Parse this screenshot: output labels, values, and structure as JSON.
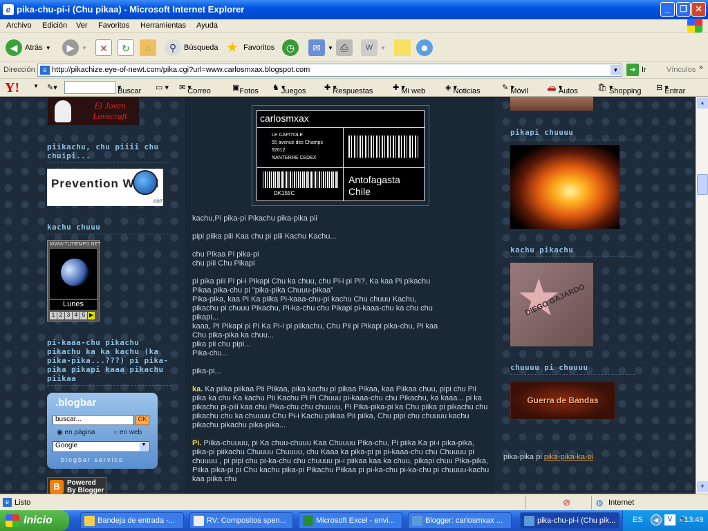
{
  "window": {
    "title": "pika-chu-pi-i (Chu pikaa) - Microsoft Internet Explorer"
  },
  "menu": [
    "Archivo",
    "Edición",
    "Ver",
    "Favoritos",
    "Herramientas",
    "Ayuda"
  ],
  "toolbar": {
    "back": "Atrás",
    "search": "Búsqueda",
    "favorites": "Favoritos"
  },
  "address": {
    "label": "Dirección",
    "url": "http://pikachize.eye-of-newt.com/pika.cgi?url=www.carlosmxax.blogspot.com",
    "go": "Ir",
    "links": "Vínculos"
  },
  "yahoo": {
    "search": "Buscar",
    "items": [
      "Correo",
      "Fotos",
      "Juegos",
      "Respuestas",
      "Mi web",
      "Noticias",
      "Móvil",
      "Autos",
      "Shopping",
      "Entrar"
    ]
  },
  "left": {
    "banner_text": "El Joven Lovecraft",
    "heading1": "piikachu, chu piiii chu chuipi...",
    "prevention": "Prevention World",
    "prevention_sub": ".com",
    "heading2": "kachu chuuu",
    "moon_site": "WWW.TUTIEMPO.NET",
    "moon_day": "Lunes",
    "moon_pages": [
      "1",
      "2",
      "3",
      "4",
      "5"
    ],
    "heading3": "pi-kaaa-chu pikachu pikachu ka ka kachu (ka pika-pika...???) pi pika-pika pikapi kaaa pikachu piikaa",
    "blogbar": {
      "title": ".blogbar",
      "input": "buscar...",
      "ok": "OK",
      "opt1": "en página",
      "opt2": "en web",
      "select": "Google",
      "service": "blogbar service"
    },
    "blogger": "Powered By Blogger"
  },
  "center": {
    "label": {
      "name": "carlosmxax",
      "address": [
        "LE CAPITOLE",
        "55 avenue des Champs",
        "92012",
        "NANTERRE CEDEX"
      ],
      "code": "DK155C",
      "city": "Antofagasta Chile"
    },
    "lines": [
      "kachu,Pi pika-pi Pikachu pika-pika pii",
      "",
      "pipi piika piii Kaa chu pi piii Kachu Kachu...",
      "",
      "chu Pikaa Pi pika-pi",
      "chu piii Chu Pikapi",
      "",
      "pi pika piii Pi pi-i Pikapi Chu ka chuu, chu Pi-i pi Pi?, Ka kaa Pi pikachu",
      "Pikaa pika-chu pi \"pika-pika Chuuu-pikaa\"",
      "Pika-pika, kaa Pi Ka piika Pi-kaaa-chu-pi kachu Chu chuuu Kachu,",
      "pikachu pi chuuu Pikachu, Pi-ka-chu chu Pikapi pi-kaaa-chu ka chu chu",
      "pikapi...",
      "kaaa, Pi Pikapi pi Pi Ka Pi-i pi piikachu, Chu Pii pi Pikapi pika-chu, Pi kaa",
      "Chu pika-pika ka chuu...",
      "pika pii chu pipi...",
      "Pika-chu...",
      "",
      "pika-pi..."
    ],
    "p1_lead": "ka.",
    "p1": "Ka piika piikaa Pii Piikaa, pika kachu pi pikaa Pikaa, kaa Piikaa chuu, pipi chu Pii pika ka chu Ka kachu Pii Kachu Pi Pi Chuuu pi-kaaa-chu chu Pikachu, ka kaaa... pi ka pikachu pi-piii kaa chu Pika-chu chu chuuuu, Pi Pika-pika-pi ka Chu piika pi pikachu chu pikachu chu ka chuuuu Chu Pi-i Kachu piikaa Pii piika, Chu pipi chu chuuuu kachu pikachu pikachu pika-pika...",
    "p2_lead": "Pi.",
    "p2": "Piika-chuuuu, pi Ka chuu-chuuu Kaa Chuuuu Pika-chu, Pi piika Ka pi-i pika-pika, pika-pi piikachu Chuuuu Chuuuu, chu Kaaa ka pika-pi pi pi-kaaa-chu chu Chuuuu pi chuuuu , pi pipi chu pi-ka-chu chu chuuuu pi-i piikaa kaa ka chuu, pikapi chuu Pika-pika, Piika pika-pi pi Chu kachu pika-pi Pikachu Piikaa pi pi-ka-chu pi-ka-chu pi chuuuu-kachu kaa piika chu"
  },
  "right": {
    "heading1": "pikapi chuuuu",
    "heading2": "kachu pikachu",
    "star_text": "DIEGO GAJARDO",
    "heading3": "chuuuu pi chuuuu",
    "guerra": "Guerra de Bandas",
    "footer": "pika-pika pi",
    "footer_link": "pika-pika-ka-pi"
  },
  "status": {
    "text": "Listo",
    "zone": "Internet"
  },
  "taskbar": {
    "start": "Inicio",
    "tasks": [
      "Bandeja de entrada -...",
      "RV: Compositos spen...",
      "Microsoft Excel - envi...",
      "Blogger: carlosmxax ...",
      "pika-chu-pi-i (Chu pik..."
    ],
    "lang": "ES",
    "clock": "13:49"
  }
}
